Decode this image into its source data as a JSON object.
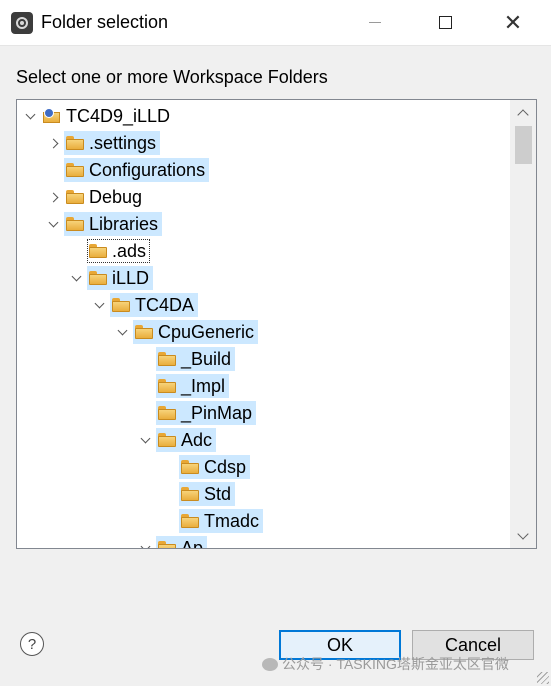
{
  "window": {
    "title": "Folder selection",
    "prompt": "Select one or more Workspace Folders"
  },
  "tree": [
    {
      "label": "TC4D9_iLLD",
      "depth": 0,
      "expander": "down",
      "icon": "project-icon",
      "selected": false
    },
    {
      "label": ".settings",
      "depth": 1,
      "expander": "right",
      "icon": "folder-icon",
      "selected": true
    },
    {
      "label": "Configurations",
      "depth": 1,
      "expander": "none",
      "icon": "folder-icon",
      "selected": true
    },
    {
      "label": "Debug",
      "depth": 1,
      "expander": "right",
      "icon": "folder-icon",
      "selected": false
    },
    {
      "label": "Libraries",
      "depth": 1,
      "expander": "down",
      "icon": "folder-icon",
      "selected": true
    },
    {
      "label": ".ads",
      "depth": 2,
      "expander": "none",
      "icon": "folder-icon",
      "selected": false,
      "focused": true
    },
    {
      "label": "iLLD",
      "depth": 2,
      "expander": "down",
      "icon": "folder-icon",
      "selected": true
    },
    {
      "label": "TC4DA",
      "depth": 3,
      "expander": "down",
      "icon": "folder-icon",
      "selected": true
    },
    {
      "label": "CpuGeneric",
      "depth": 4,
      "expander": "down",
      "icon": "folder-icon",
      "selected": true
    },
    {
      "label": "_Build",
      "depth": 5,
      "expander": "none",
      "icon": "folder-icon",
      "selected": true
    },
    {
      "label": "_Impl",
      "depth": 5,
      "expander": "none",
      "icon": "folder-icon",
      "selected": true
    },
    {
      "label": "_PinMap",
      "depth": 5,
      "expander": "none",
      "icon": "folder-icon",
      "selected": true
    },
    {
      "label": "Adc",
      "depth": 5,
      "expander": "down",
      "icon": "folder-icon",
      "selected": true
    },
    {
      "label": "Cdsp",
      "depth": 6,
      "expander": "none",
      "icon": "folder-icon",
      "selected": true
    },
    {
      "label": "Std",
      "depth": 6,
      "expander": "none",
      "icon": "folder-icon",
      "selected": true
    },
    {
      "label": "Tmadc",
      "depth": 6,
      "expander": "none",
      "icon": "folder-icon",
      "selected": true
    },
    {
      "label": "Ap",
      "depth": 5,
      "expander": "down",
      "icon": "folder-icon",
      "selected": true
    }
  ],
  "buttons": {
    "ok": "OK",
    "cancel": "Cancel",
    "help": "?"
  },
  "watermark": "公众号 · TASKING塔斯金亚太区官微",
  "colors": {
    "selection": "#cce8ff",
    "default_button_border": "#0078d7"
  }
}
